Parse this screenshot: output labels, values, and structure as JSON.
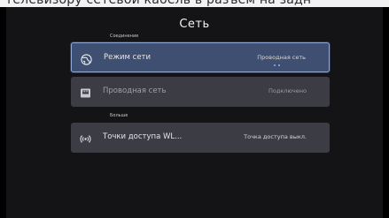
{
  "header_strip_text": "телевизору сетевой кабель в разъем на задн",
  "title": "Сеть",
  "sections": {
    "connection": "Соединение",
    "more": "Больше"
  },
  "rows": [
    {
      "label": "Режим сети",
      "value": "Проводная сеть",
      "icon": "globe-icon",
      "focused": true
    },
    {
      "label": "Проводная сеть",
      "value": "Подключено",
      "icon": "ethernet-icon",
      "focused": false
    },
    {
      "label": "Точки доступа WL...",
      "value": "Точка доступа выкл.",
      "icon": "wireless-hotspot-icon",
      "focused": false
    }
  ],
  "colors": {
    "background": "#141416",
    "row": "#3b3c44",
    "row_focused": "#3e4f71",
    "focus_border": "#8fa9d8",
    "accent_dot": "#8fb4ff"
  }
}
